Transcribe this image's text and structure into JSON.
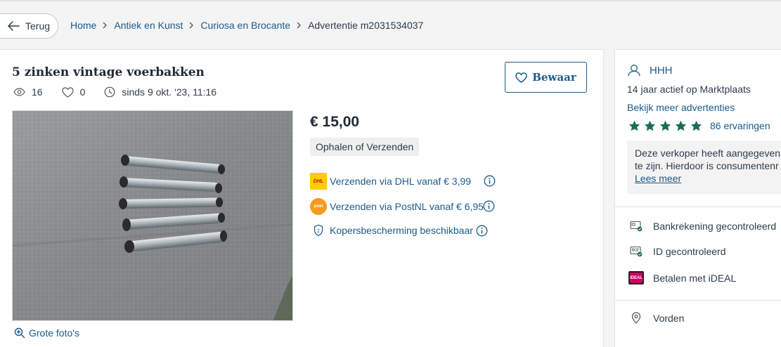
{
  "nav": {
    "back_label": "Terug",
    "breadcrumbs": [
      "Home",
      "Antiek en Kunst",
      "Curiosa en Brocante"
    ],
    "current": "Advertentie m2031534037"
  },
  "listing": {
    "title": "5 zinken vintage voerbakken",
    "views": "16",
    "favorites": "0",
    "date": "sinds 9 okt. '23, 11:16",
    "save_label": "Bewaar",
    "zoom_label": "Grote foto's",
    "price": "€ 15,00",
    "delivery": "Ophalen of Verzenden",
    "shipping": [
      {
        "label": "Verzenden via DHL vanaf € 3,99",
        "logo": "DHL"
      },
      {
        "label": "Verzenden via PostNL vanaf € 6,95",
        "logo": "post"
      }
    ],
    "protection": "Kopersbescherming beschikbaar"
  },
  "seller": {
    "name": "HHH",
    "active": "14 jaar actief op Marktplaats",
    "more_label": "Bekijk meer advertenties",
    "rating_stars": 5,
    "reviews": "86 ervaringen",
    "notice_line1": "Deze verkoper heeft aangegeven ",
    "notice_line2": "te zijn. Hierdoor is consumentenr",
    "notice_link": "Lees meer",
    "badges": [
      "Bankrekening gecontroleerd",
      "ID gecontroleerd",
      "Betalen met iDEAL"
    ],
    "ideal_logo": "iDEAL",
    "location": "Vorden"
  },
  "colors": {
    "link": "#1a5a8c",
    "star": "#1f6b5a",
    "text": "#2d3c4d"
  }
}
